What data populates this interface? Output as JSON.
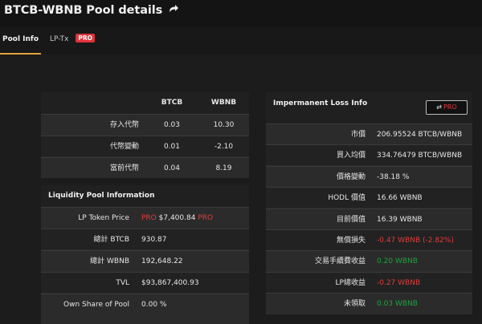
{
  "header": {
    "title": "BTCB-WBNB Pool details"
  },
  "tabs": [
    {
      "label": "Pool Info",
      "active": true
    },
    {
      "label": "LP-Tx",
      "badge": "PRO"
    }
  ],
  "token_table": {
    "columns": [
      "BTCB",
      "WBNB"
    ],
    "rows": [
      {
        "label": "存入代幣",
        "btcb": "0.03",
        "wbnb": "10.30"
      },
      {
        "label": "代幣變動",
        "btcb": "0.01",
        "wbnb": "-2.10"
      },
      {
        "label": "當前代幣",
        "btcb": "0.04",
        "wbnb": "8.19"
      }
    ]
  },
  "liquidity": {
    "title": "Liquidity Pool Information",
    "rows": [
      {
        "label": "LP Token Price",
        "pro_before": "PRO",
        "value": "$7,400.84",
        "pro_after": "PRO"
      },
      {
        "label": "總計 BTCB",
        "value": "930.87"
      },
      {
        "label": "總計 WBNB",
        "value": "192,648.22"
      },
      {
        "label": "TVL",
        "value": "$93,867,400.93"
      },
      {
        "label": "Own Share of Pool",
        "value": "0.00 %"
      }
    ]
  },
  "impermanent": {
    "title": "Impermanent Loss Info",
    "button_label": "PRO",
    "rows": [
      {
        "label": "市價",
        "value": "206.95524 BTCB/WBNB",
        "color": "#e6e6e6"
      },
      {
        "label": "買入均價",
        "value": "334.76479 BTCB/WBNB",
        "color": "#e6e6e6"
      },
      {
        "label": "價格變動",
        "value": "-38.18 %",
        "color": "#e6e6e6"
      },
      {
        "label": "HODL 價值",
        "value": "16.66 WBNB",
        "color": "#e6e6e6"
      },
      {
        "label": "目前價值",
        "value": "16.39 WBNB",
        "color": "#e6e6e6"
      },
      {
        "label": "無償損失",
        "value": "-0.47 WBNB (-2.82%)",
        "color": "#e13c3c"
      },
      {
        "label": "交易手續費收益",
        "value": "0.20 WBNB",
        "color": "#1aa53a"
      },
      {
        "label": "LP總收益",
        "value": "-0.27 WBNB",
        "color": "#e13c3c"
      },
      {
        "label": "未領取",
        "value": "0.03 WBNB",
        "color": "#1aa53a"
      }
    ]
  }
}
